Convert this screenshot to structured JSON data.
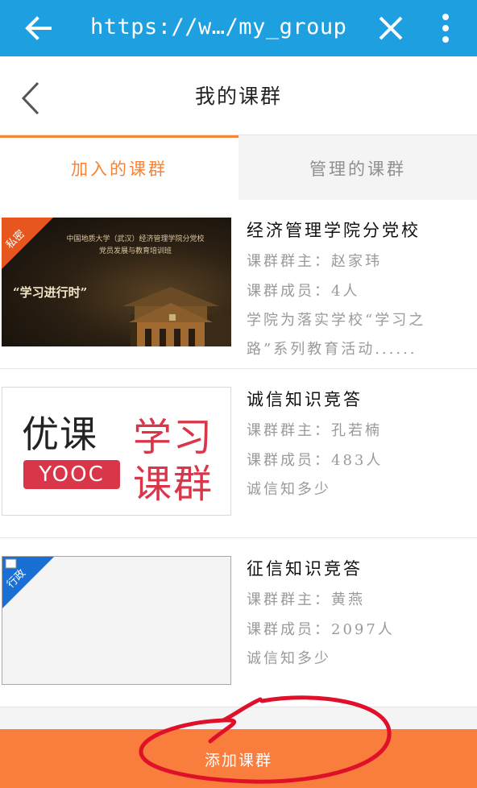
{
  "browser": {
    "url": "https://w…/my_group",
    "icons": {
      "back": "arrow-left-icon",
      "close": "close-icon",
      "menu": "more-vert-icon"
    }
  },
  "header": {
    "title": "我的课群",
    "back_icon": "chevron-left-icon"
  },
  "tabs": [
    {
      "label": "加入的课群",
      "active": true
    },
    {
      "label": "管理的课群",
      "active": false
    }
  ],
  "groups": [
    {
      "name": "经济管理学院分党校",
      "owner_label": "课群群主：",
      "owner": "赵家玮",
      "members_label": "课群成员：",
      "members": "4人",
      "description": "学院为落实学校“学习之路”系列教育活动......",
      "badge": "私密",
      "thumb": {
        "line1": "中国地质大学（武汉）经济管理学院分党校",
        "line2": "党员发展与教育培训班",
        "slogan": "“学习进行时”"
      }
    },
    {
      "name": "诚信知识竞答",
      "owner_label": "课群群主：",
      "owner": "孔若楠",
      "members_label": "课群成员：",
      "members": "483人",
      "description": "诚信知多少",
      "thumb": {
        "brand": "优课",
        "brand_sub": "YOOC",
        "tag1": "学习",
        "tag2": "课群"
      }
    },
    {
      "name": "征信知识竞答",
      "owner_label": "课群群主：",
      "owner": "黄燕",
      "members_label": "课群成员：",
      "members": "2097人",
      "description": "诚信知多少",
      "badge": "行政"
    }
  ],
  "footer": {
    "add_label": "添加课群"
  },
  "colors": {
    "browser_bar": "#1e9fe0",
    "accent": "#f58436",
    "add_bar": "#f97d3c",
    "badge_private": "#e8561f",
    "badge_admin": "#1a6fd4",
    "annotation": "#e0102a"
  }
}
